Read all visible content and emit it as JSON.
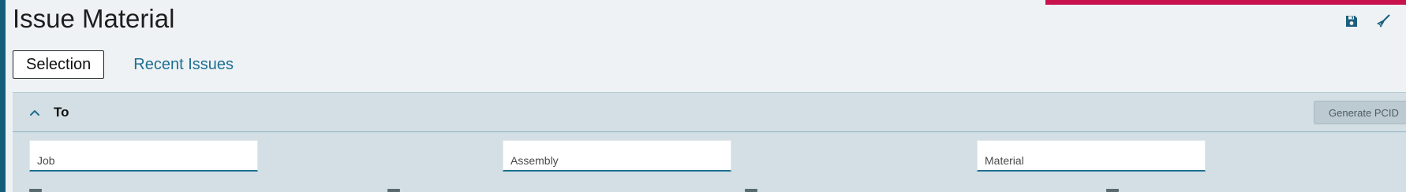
{
  "page": {
    "title": "Issue Material"
  },
  "toolbar": {
    "save_icon": "save-icon",
    "clear_icon": "broom-icon"
  },
  "tabs": [
    {
      "label": "Selection",
      "active": true
    },
    {
      "label": "Recent Issues",
      "active": false
    }
  ],
  "section": {
    "title": "To",
    "expanded": true,
    "collapse_icon": "chevron-up-icon",
    "generate_button_label": "Generate PCID"
  },
  "fields": {
    "job": {
      "placeholder": "Job",
      "value": ""
    },
    "assembly": {
      "placeholder": "Assembly",
      "value": ""
    },
    "material": {
      "placeholder": "Material",
      "value": ""
    }
  },
  "colors": {
    "accent": "#145e7a",
    "link": "#1f6f91",
    "notice": "#c8124e",
    "section_bg": "#d3dfe4"
  }
}
